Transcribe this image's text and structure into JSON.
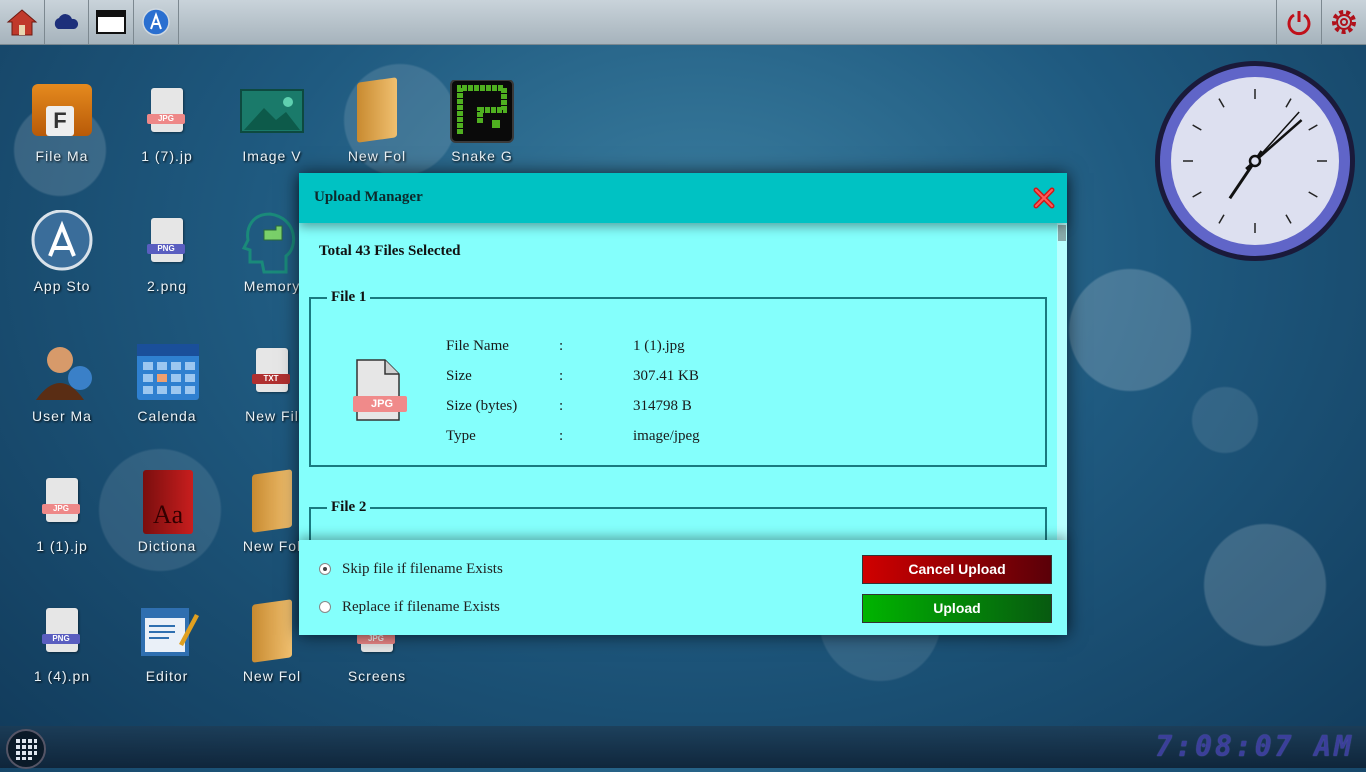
{
  "topbar": {
    "left_icons": [
      "home-icon",
      "cloud-icon",
      "window-icon",
      "app-store-icon"
    ],
    "right_icons": [
      "power-icon",
      "settings-gear-icon"
    ]
  },
  "desktop": {
    "icons": [
      {
        "label": "File Ma",
        "icon": "file-manager-icon"
      },
      {
        "label": "1 (7).jp",
        "icon": "jpg-file-icon",
        "tag": "JPG"
      },
      {
        "label": "Image V",
        "icon": "image-viewer-icon"
      },
      {
        "label": "New Fol",
        "icon": "folder-icon"
      },
      {
        "label": "Snake G",
        "icon": "snake-game-icon"
      },
      {
        "label": "App Sto",
        "icon": "app-store-icon"
      },
      {
        "label": "2.png",
        "icon": "png-file-icon",
        "tag": "PNG"
      },
      {
        "label": "Memory",
        "icon": "memory-game-icon"
      },
      {
        "label": "User Ma",
        "icon": "user-manager-icon"
      },
      {
        "label": "Calenda",
        "icon": "calendar-icon"
      },
      {
        "label": "New Fil",
        "icon": "txt-file-icon",
        "tag": "TXT"
      },
      {
        "label": "1 (1).jp",
        "icon": "jpg-file-icon",
        "tag": "JPG"
      },
      {
        "label": "Dictiona",
        "icon": "dictionary-icon"
      },
      {
        "label": "New Fol",
        "icon": "folder-icon"
      },
      {
        "label": "1 (4).pn",
        "icon": "png-file-icon",
        "tag": "PNG"
      },
      {
        "label": "Editor",
        "icon": "editor-icon"
      },
      {
        "label": "New Fol",
        "icon": "folder-icon"
      },
      {
        "label": "Screens",
        "icon": "jpg-file-icon",
        "tag": "JPG"
      }
    ]
  },
  "modal": {
    "title": "Upload Manager",
    "total": "Total 43 Files Selected",
    "files": [
      {
        "legend": "File 1",
        "type_badge": "JPG",
        "fields": [
          {
            "key": "File Name",
            "sep": ":",
            "value": "1 (1).jpg"
          },
          {
            "key": "Size",
            "sep": ":",
            "value": "307.41 KB"
          },
          {
            "key": "Size (bytes)",
            "sep": ":",
            "value": "314798 B"
          },
          {
            "key": "Type",
            "sep": ":",
            "value": "image/jpeg"
          }
        ]
      },
      {
        "legend": "File 2"
      }
    ],
    "options": [
      {
        "label": "Skip file if filename Exists",
        "checked": true
      },
      {
        "label": "Replace if filename Exists",
        "checked": false
      }
    ],
    "cancel_label": "Cancel Upload",
    "upload_label": "Upload"
  },
  "taskbar": {
    "clock_text": "7:08:07 AM",
    "apps_icon": "app-grid-icon"
  },
  "analog_clock": {
    "hour": 7,
    "minute": 8,
    "second": 7
  },
  "colors": {
    "accent": "#00c2c3",
    "modal_bg": "#84fffc",
    "cancel": "#d00000",
    "upload": "#00b400"
  }
}
